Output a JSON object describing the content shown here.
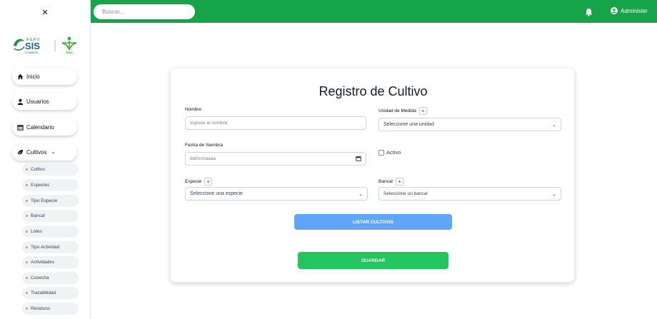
{
  "sidebar": {
    "close_label": "×",
    "logo": {
      "brand_top": "AGRO",
      "brand_main": "SIS",
      "brand_sub": "TIC'AMBORE",
      "partner": "SENA"
    },
    "items": [
      {
        "label": "Inicio",
        "icon": "home-icon"
      },
      {
        "label": "Usuarios",
        "icon": "user-icon"
      },
      {
        "label": "Calendario",
        "icon": "calendar-icon"
      },
      {
        "label": "Cultivos",
        "icon": "leaf-icon",
        "chevron": "⌄"
      }
    ],
    "subitems": [
      "Cultivo",
      "Especies",
      "Tipo Especie",
      "Bancal",
      "Lotes",
      "Tipo Actividad",
      "Actividades",
      "Cosecha",
      "Trazabilidad",
      "Residuos"
    ]
  },
  "topbar": {
    "search_placeholder": "Buscar...",
    "user_label": "Administer",
    "accent": "#16a34a"
  },
  "form": {
    "title": "Registro de Cultivo",
    "nombre_label": "Nombre",
    "nombre_placeholder": "Ingrese el nombre",
    "unidad_label": "Unidad de Medida",
    "unidad_value": "Seleccione una unidad",
    "fecha_label": "Fecha de Siembra",
    "fecha_value": "dd/mm/aaaa",
    "activo_label": "Activo",
    "especie_label": "Especie",
    "especie_value": "Seleccione una especie",
    "bancal_label": "Bancal",
    "bancal_value": "Seleccione un bancal",
    "plus": "+",
    "chevron": "⌄",
    "list_button": "LISTAR CULTIVOS",
    "save_button": "GUARDAR"
  }
}
